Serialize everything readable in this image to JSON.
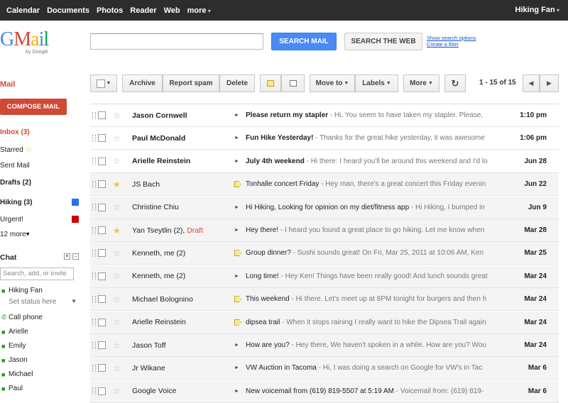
{
  "topnav": {
    "items": [
      "Calendar",
      "Documents",
      "Photos",
      "Reader",
      "Web",
      "more"
    ],
    "user": "Hiking Fan"
  },
  "header": {
    "logo_text": "Gmail",
    "logo_sub": "by Google",
    "search_value": "",
    "search_mail_label": "SEARCH MAIL",
    "search_web_label": "SEARCH THE WEB",
    "show_search_options": "Show search options",
    "create_filter": "Create a filter"
  },
  "sidebar": {
    "mail_label": "Mail",
    "compose_label": "COMPOSE MAIL",
    "items": [
      {
        "label": "Inbox (3)"
      },
      {
        "label": "Starred"
      },
      {
        "label": "Sent Mail"
      },
      {
        "label": "Drafts (2)"
      },
      {
        "label": "Hiking (3)",
        "color": "#2a6ef0"
      },
      {
        "label": "Urgent!",
        "color": "#cc0000"
      },
      {
        "label": "12 more▾"
      }
    ]
  },
  "chat": {
    "title": "Chat",
    "search_placeholder": "Search, add, or invite",
    "me": "Hiking Fan",
    "status": "Set status here",
    "contacts": [
      "Call phone",
      "Arielle",
      "Emily",
      "Jason",
      "Michael",
      "Paul"
    ]
  },
  "toolbar": {
    "archive": "Archive",
    "report_spam": "Report spam",
    "delete": "Delete",
    "move_to": "Move to",
    "labels": "Labels",
    "more": "More",
    "pager": "1 - 15 of 15"
  },
  "messages": [
    {
      "sender": "Jason Cornwell",
      "draft": "",
      "subject": "Please return my stapler",
      "snippet": " - Hi, You seem to have taken my stapler. Please,",
      "date": "1:10 pm",
      "unread": true,
      "starred": false,
      "marker": false
    },
    {
      "sender": "Paul McDonald",
      "draft": "",
      "subject": "Fun Hike Yesterday!",
      "snippet": " - Thanks for the great hike yesterday, it was awesome",
      "date": "1:06 pm",
      "unread": true,
      "starred": false,
      "marker": false
    },
    {
      "sender": "Arielle Reinstein",
      "draft": "",
      "subject": "July 4th weekend",
      "snippet": " - Hi there: I heard you'll be around this weekend and I'd lo",
      "date": "Jun 28",
      "unread": true,
      "starred": false,
      "marker": false
    },
    {
      "sender": "JS Bach",
      "draft": "",
      "subject": "Tonhalle concert Friday",
      "snippet": " - Hey man, there's a great concert this Friday evenin",
      "date": "Jun 22",
      "unread": false,
      "starred": true,
      "marker": true
    },
    {
      "sender": "Christine Chiu",
      "draft": "",
      "subject": "Hi Hiking, Looking for opinion on my diet/fitness app",
      "snippet": " - Hi Hiking, I bumped in",
      "date": "Jun 9",
      "unread": false,
      "starred": false,
      "marker": false
    },
    {
      "sender": "Yan Tseytlin (2), ",
      "draft": "Draft",
      "subject": "Hey there!",
      "snippet": " - I heard you found a great place to go hiking. Let me know when",
      "date": "Mar 28",
      "unread": false,
      "starred": true,
      "marker": false
    },
    {
      "sender": "Kenneth, me (2)",
      "draft": "",
      "subject": "Group dinner?",
      "snippet": " - Sushi sounds great! On Fri, Mar 25, 2011 at 10:06 AM, Ken",
      "date": "Mar 25",
      "unread": false,
      "starred": false,
      "marker": true
    },
    {
      "sender": "Kenneth, me (2)",
      "draft": "",
      "subject": "Long time!",
      "snippet": " - Hey Ken! Things have been really good! And lunch sounds great",
      "date": "Mar 24",
      "unread": false,
      "starred": false,
      "marker": false
    },
    {
      "sender": "Michael Bolognino",
      "draft": "",
      "subject": "This weekend",
      "snippet": " - Hi there. Let's meet up at 8PM tonight for burgers and then h",
      "date": "Mar 24",
      "unread": false,
      "starred": false,
      "marker": true
    },
    {
      "sender": "Arielle Reinstein",
      "draft": "",
      "subject": "dipsea trail",
      "snippet": " - When it stops raining I really want to hike the Dipsea Trail again",
      "date": "Mar 24",
      "unread": false,
      "starred": false,
      "marker": true
    },
    {
      "sender": "Jason Toff",
      "draft": "",
      "subject": "How are you?",
      "snippet": " - Hey there, We haven't spoken in a while. How are you? Wou",
      "date": "Mar 24",
      "unread": false,
      "starred": false,
      "marker": false
    },
    {
      "sender": "Jr Wikane",
      "draft": "",
      "subject": "VW Auction in Tacoma",
      "snippet": " - Hi, I was doing a search on Google for VW's in Tac",
      "date": "Mar 6",
      "unread": false,
      "starred": false,
      "marker": false
    },
    {
      "sender": "Google Voice",
      "draft": "",
      "subject": "New voicemail from (619) 819-5507 at 5:19 AM",
      "snippet": " - Voicemail from: (619) 819-",
      "date": "Mar 6",
      "unread": false,
      "starred": false,
      "marker": false
    }
  ]
}
